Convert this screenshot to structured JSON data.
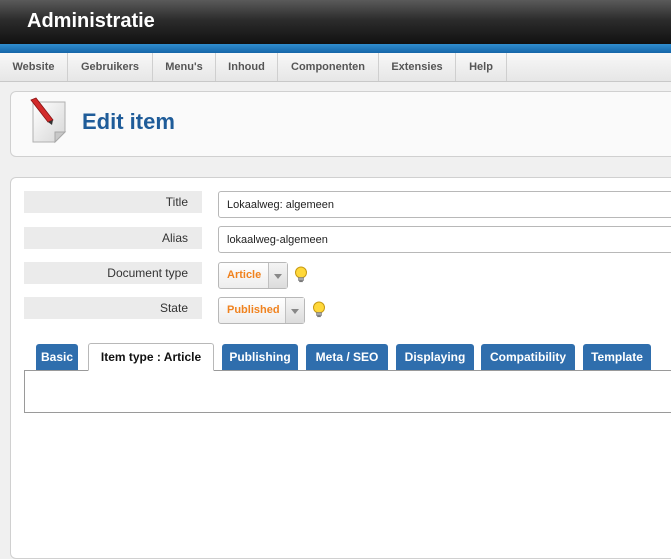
{
  "app": {
    "title": "Administratie"
  },
  "menu": {
    "items": [
      "Website",
      "Gebruikers",
      "Menu's",
      "Inhoud",
      "Componenten",
      "Extensies",
      "Help"
    ]
  },
  "toolbar": {
    "page_title": "Edit item",
    "icon": "edit-page-icon"
  },
  "form": {
    "title_label": "Title",
    "title_value": "Lokaalweg: algemeen",
    "alias_label": "Alias",
    "alias_value": "lokaalweg-algemeen",
    "doctype_label": "Document type",
    "doctype_value": "Article",
    "state_label": "State",
    "state_value": "Published",
    "help_icon": "lightbulb-icon"
  },
  "tabs": [
    "Basic",
    "Item type : Article",
    "Publishing",
    "Meta / SEO",
    "Displaying",
    "Compatibility",
    "Template"
  ],
  "active_tab": "Item type : Article",
  "colors": {
    "header_dark": "#2c2c2c",
    "accent_blue": "#2f6ead",
    "title_blue": "#1f5c99",
    "select_orange": "#f0821e"
  }
}
